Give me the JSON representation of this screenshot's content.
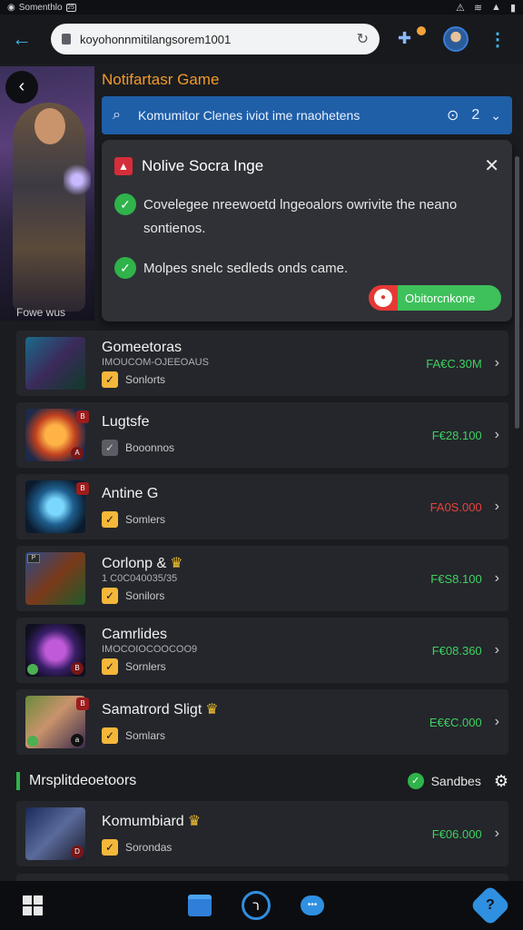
{
  "status_bar": {
    "app": "Somenthlo",
    "badge": "25"
  },
  "browser": {
    "url": "koyohonnmitilangsorem1001",
    "colors": {
      "accent": "#3fb7e8",
      "bar": "#17191d"
    }
  },
  "hero": {
    "caption": "Fowe wus"
  },
  "section": {
    "title": "Notifartasr Game"
  },
  "search": {
    "text": "Komumitor Clenes iviot ime rnaohetens",
    "count": "2"
  },
  "notice": {
    "title": "Nolive Socra Inge",
    "items": [
      "Covelegee nreewoetd lngeoalors owrivite the neano sontienos.",
      "Molpes snelc sedleds onds came."
    ],
    "button": "Obitorcnkone"
  },
  "games": [
    {
      "name": "Gomeetoras",
      "crown": "",
      "sub": "IMOUCOM-OJEEOAUS",
      "tag": "Sonlorts",
      "price": "FA€C.30M",
      "price_color": "green",
      "checked": true
    },
    {
      "name": "Lugtsfe",
      "crown": "",
      "sub": "",
      "tag": "Booonnos",
      "price": "F€28.100",
      "price_color": "green",
      "checked": false
    },
    {
      "name": "Antine G",
      "crown": "",
      "sub": "",
      "tag": "Somlers",
      "price": "FA0S.000",
      "price_color": "red",
      "checked": true
    },
    {
      "name": "Corlonp &",
      "crown": "♛",
      "sub": "1 C0C040035/35",
      "tag": "Sonilors",
      "price": "F€S8.100",
      "price_color": "green",
      "checked": true
    },
    {
      "name": "Camrlides",
      "crown": "",
      "sub": "IMOCOIOCOOCOO9",
      "tag": "Sornlers",
      "price": "F€08.360",
      "price_color": "green",
      "checked": true
    },
    {
      "name": "Samatrord Sligt",
      "crown": "♛",
      "sub": "",
      "tag": "Somlars",
      "price": "E€€C.000",
      "price_color": "green",
      "checked": true
    }
  ],
  "subheader": {
    "title": "Mrsplitdeoetoors",
    "right_label": "Sandbes"
  },
  "games2": [
    {
      "name": "Komumbiard",
      "crown": "♛",
      "sub": "",
      "tag": "Sorondas",
      "price": "F€06.000",
      "price_color": "green",
      "checked": true
    }
  ]
}
